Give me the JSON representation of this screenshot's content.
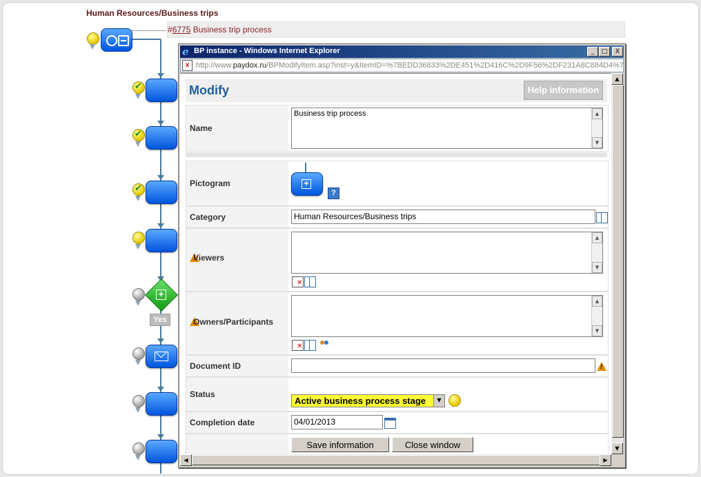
{
  "breadcrumb": "Human Resources/Business trips",
  "process": {
    "hash": "#",
    "number": "6775",
    "title": "Business trip process"
  },
  "flow": {
    "yes_label": "Yes"
  },
  "window": {
    "title": "BP instance - Windows Internet Explorer",
    "address_prefix": "http://www.",
    "address_domain": "paydox.ru",
    "address_rest": "/BPModifyItem.asp?inst=y&ItemID=%7BEDD36833%2DE451%2D416C%2D9F56%2DF231A8C884D4%7",
    "btn_min": "_",
    "btn_max": "□",
    "btn_close": "X"
  },
  "form": {
    "title": "Modify",
    "help_label": "Help information",
    "name_label": "Name",
    "name_value": "Business trip process",
    "pictogram_label": "Pictogram",
    "pictogram_help": "?",
    "category_label": "Category",
    "category_value": "Human Resources/Business trips",
    "viewers_label": "Viewers",
    "owners_label": "Owners/Participants",
    "docid_label": "Document ID",
    "docid_value": "",
    "status_label": "Status",
    "status_value": "Active business process stage",
    "completion_label": "Completion date",
    "completion_value": "04/01/2013",
    "save_label": "Save information",
    "close_label": "Close window"
  },
  "colors": {
    "accent": "#1f5e9a",
    "status_highlight": "#ffff33",
    "node_blue": "#0055dd",
    "decision_green": "#109a10"
  }
}
